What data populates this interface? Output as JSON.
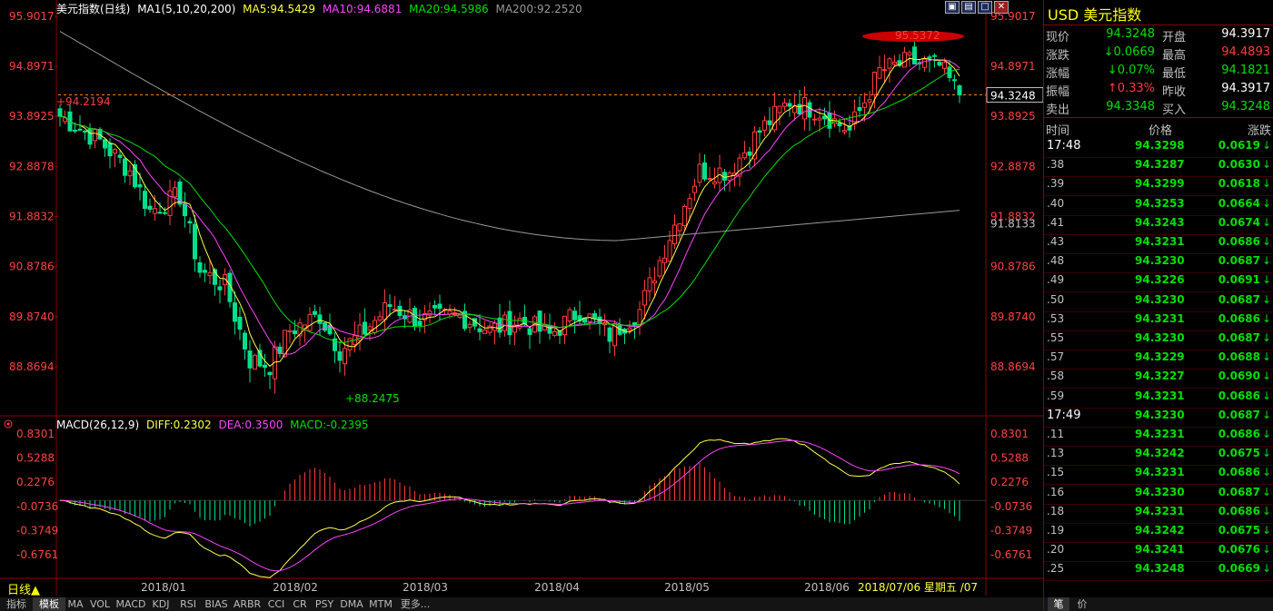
{
  "header": {
    "title": "美元指数(日线)",
    "ma_label": "MA1(5,10,20,200)",
    "ma5": "MA5:94.5429",
    "ma10": "MA10:94.6881",
    "ma20": "MA20:94.5986",
    "ma200": "MA200:92.2520"
  },
  "macd_header": {
    "label": "MACD(26,12,9)",
    "diff": "DIFF:0.2302",
    "dea": "DEA:0.3500",
    "macd": "MACD:-0.2395"
  },
  "colors": {
    "up": "#ff3c3c",
    "down": "#00e08c",
    "ma5": "#ffff44",
    "ma10": "#ff44ff",
    "ma20": "#00e000",
    "ma200": "#999999",
    "axis_text": "#ff4040",
    "grid": "#8a0000"
  },
  "price_axis": [
    "95.9017",
    "94.8971",
    "93.8925",
    "92.8878",
    "91.8832",
    "90.8786",
    "89.8740",
    "88.8694"
  ],
  "price_axis_extra": "91.8133",
  "current_price_tag": "94.3248",
  "macd_axis": [
    "0.8301",
    "0.5288",
    "0.2276",
    "-0.0736",
    "-0.3749",
    "-0.6761"
  ],
  "annotations": {
    "high": "95.5372",
    "low": "88.2475",
    "ref": "94.2194"
  },
  "x_axis": [
    "2018/01",
    "2018/02",
    "2018/03",
    "2018/04",
    "2018/05",
    "2018/06"
  ],
  "cursor_date": "2018/07/06  星期五 /07",
  "period_label": "日线▲",
  "bottom_tabs": [
    "指标",
    "模板",
    "MA",
    "VOL",
    "MACD",
    "KDJ",
    "RSI",
    "BIAS",
    "ARBR",
    "CCI",
    "CR",
    "PSY",
    "DMA",
    "MTM",
    "更多..."
  ],
  "right_panel": {
    "title": "USD 美元指数",
    "quotes": [
      {
        "l": "现价",
        "v": "94.3248",
        "vc": "#00e000",
        "l2": "开盘",
        "v2": "94.3917",
        "v2c": "#ffffff"
      },
      {
        "l": "涨跌",
        "v": "↓0.0669",
        "vc": "#00e000",
        "l2": "最高",
        "v2": "94.4893",
        "v2c": "#ff3c3c"
      },
      {
        "l": "涨幅",
        "v": "↓0.07%",
        "vc": "#00e000",
        "l2": "最低",
        "v2": "94.1821",
        "v2c": "#00e000"
      },
      {
        "l": "振幅",
        "v": "↑0.33%",
        "vc": "#ff3c3c",
        "l2": "昨收",
        "v2": "94.3917",
        "v2c": "#ffffff"
      },
      {
        "l": "卖出",
        "v": "94.3348",
        "vc": "#00e000",
        "l2": "买入",
        "v2": "94.3248",
        "v2c": "#00e000"
      }
    ],
    "tick_header": {
      "time": "时间",
      "price": "价格",
      "change": "涨跌"
    },
    "ticks": [
      {
        "t": "17:48",
        "p": "94.3298",
        "c": "0.0619"
      },
      {
        "t": ".38",
        "p": "94.3287",
        "c": "0.0630"
      },
      {
        "t": ".39",
        "p": "94.3299",
        "c": "0.0618"
      },
      {
        "t": ".40",
        "p": "94.3253",
        "c": "0.0664"
      },
      {
        "t": ".41",
        "p": "94.3243",
        "c": "0.0674"
      },
      {
        "t": ".43",
        "p": "94.3231",
        "c": "0.0686"
      },
      {
        "t": ".48",
        "p": "94.3230",
        "c": "0.0687"
      },
      {
        "t": ".49",
        "p": "94.3226",
        "c": "0.0691"
      },
      {
        "t": ".50",
        "p": "94.3230",
        "c": "0.0687"
      },
      {
        "t": ".53",
        "p": "94.3231",
        "c": "0.0686"
      },
      {
        "t": ".55",
        "p": "94.3230",
        "c": "0.0687"
      },
      {
        "t": ".57",
        "p": "94.3229",
        "c": "0.0688"
      },
      {
        "t": ".58",
        "p": "94.3227",
        "c": "0.0690"
      },
      {
        "t": ".59",
        "p": "94.3231",
        "c": "0.0686"
      },
      {
        "t": "17:49",
        "p": "94.3230",
        "c": "0.0687"
      },
      {
        "t": ".11",
        "p": "94.3231",
        "c": "0.0686"
      },
      {
        "t": ".13",
        "p": "94.3242",
        "c": "0.0675"
      },
      {
        "t": ".15",
        "p": "94.3231",
        "c": "0.0686"
      },
      {
        "t": ".16",
        "p": "94.3230",
        "c": "0.0687"
      },
      {
        "t": ".18",
        "p": "94.3231",
        "c": "0.0686"
      },
      {
        "t": ".19",
        "p": "94.3242",
        "c": "0.0675"
      },
      {
        "t": ".20",
        "p": "94.3241",
        "c": "0.0676"
      },
      {
        "t": ".25",
        "p": "94.3248",
        "c": "0.0669"
      }
    ],
    "bottom_tabs": [
      "笔",
      "价"
    ]
  },
  "chart_data": {
    "type": "candlestick",
    "title": "美元指数(日线)",
    "price_range": [
      88.2475,
      95.9017
    ],
    "anchors": [
      {
        "i": 0,
        "v": 93.9
      },
      {
        "i": 8,
        "v": 93.4
      },
      {
        "i": 14,
        "v": 92.8
      },
      {
        "i": 18,
        "v": 92.0
      },
      {
        "i": 24,
        "v": 92.3
      },
      {
        "i": 28,
        "v": 90.8
      },
      {
        "i": 33,
        "v": 90.5
      },
      {
        "i": 38,
        "v": 89.0
      },
      {
        "i": 42,
        "v": 88.9
      },
      {
        "i": 46,
        "v": 89.6
      },
      {
        "i": 52,
        "v": 89.9
      },
      {
        "i": 56,
        "v": 89.2
      },
      {
        "i": 60,
        "v": 89.5
      },
      {
        "i": 66,
        "v": 90.1
      },
      {
        "i": 72,
        "v": 89.8
      },
      {
        "i": 80,
        "v": 89.9
      },
      {
        "i": 86,
        "v": 89.6
      },
      {
        "i": 92,
        "v": 89.8
      },
      {
        "i": 98,
        "v": 89.5
      },
      {
        "i": 104,
        "v": 90.0
      },
      {
        "i": 110,
        "v": 89.5
      },
      {
        "i": 116,
        "v": 90.0
      },
      {
        "i": 122,
        "v": 91.5
      },
      {
        "i": 128,
        "v": 92.8
      },
      {
        "i": 134,
        "v": 92.8
      },
      {
        "i": 140,
        "v": 93.6
      },
      {
        "i": 146,
        "v": 94.2
      },
      {
        "i": 152,
        "v": 94.0
      },
      {
        "i": 158,
        "v": 93.6
      },
      {
        "i": 164,
        "v": 94.8
      },
      {
        "i": 170,
        "v": 95.0
      },
      {
        "i": 176,
        "v": 94.9
      },
      {
        "i": 180,
        "v": 94.3248
      }
    ],
    "bars": 181,
    "ma_values": {
      "MA5": 94.5429,
      "MA10": 94.6881,
      "MA20": 94.5986,
      "MA200": 92.252
    },
    "macd": {
      "DIFF": 0.2302,
      "DEA": 0.35,
      "MACD": -0.2395,
      "range": [
        -0.6761,
        0.8301
      ]
    },
    "x_labels": [
      "2018/01",
      "2018/02",
      "2018/03",
      "2018/04",
      "2018/05",
      "2018/06"
    ]
  }
}
